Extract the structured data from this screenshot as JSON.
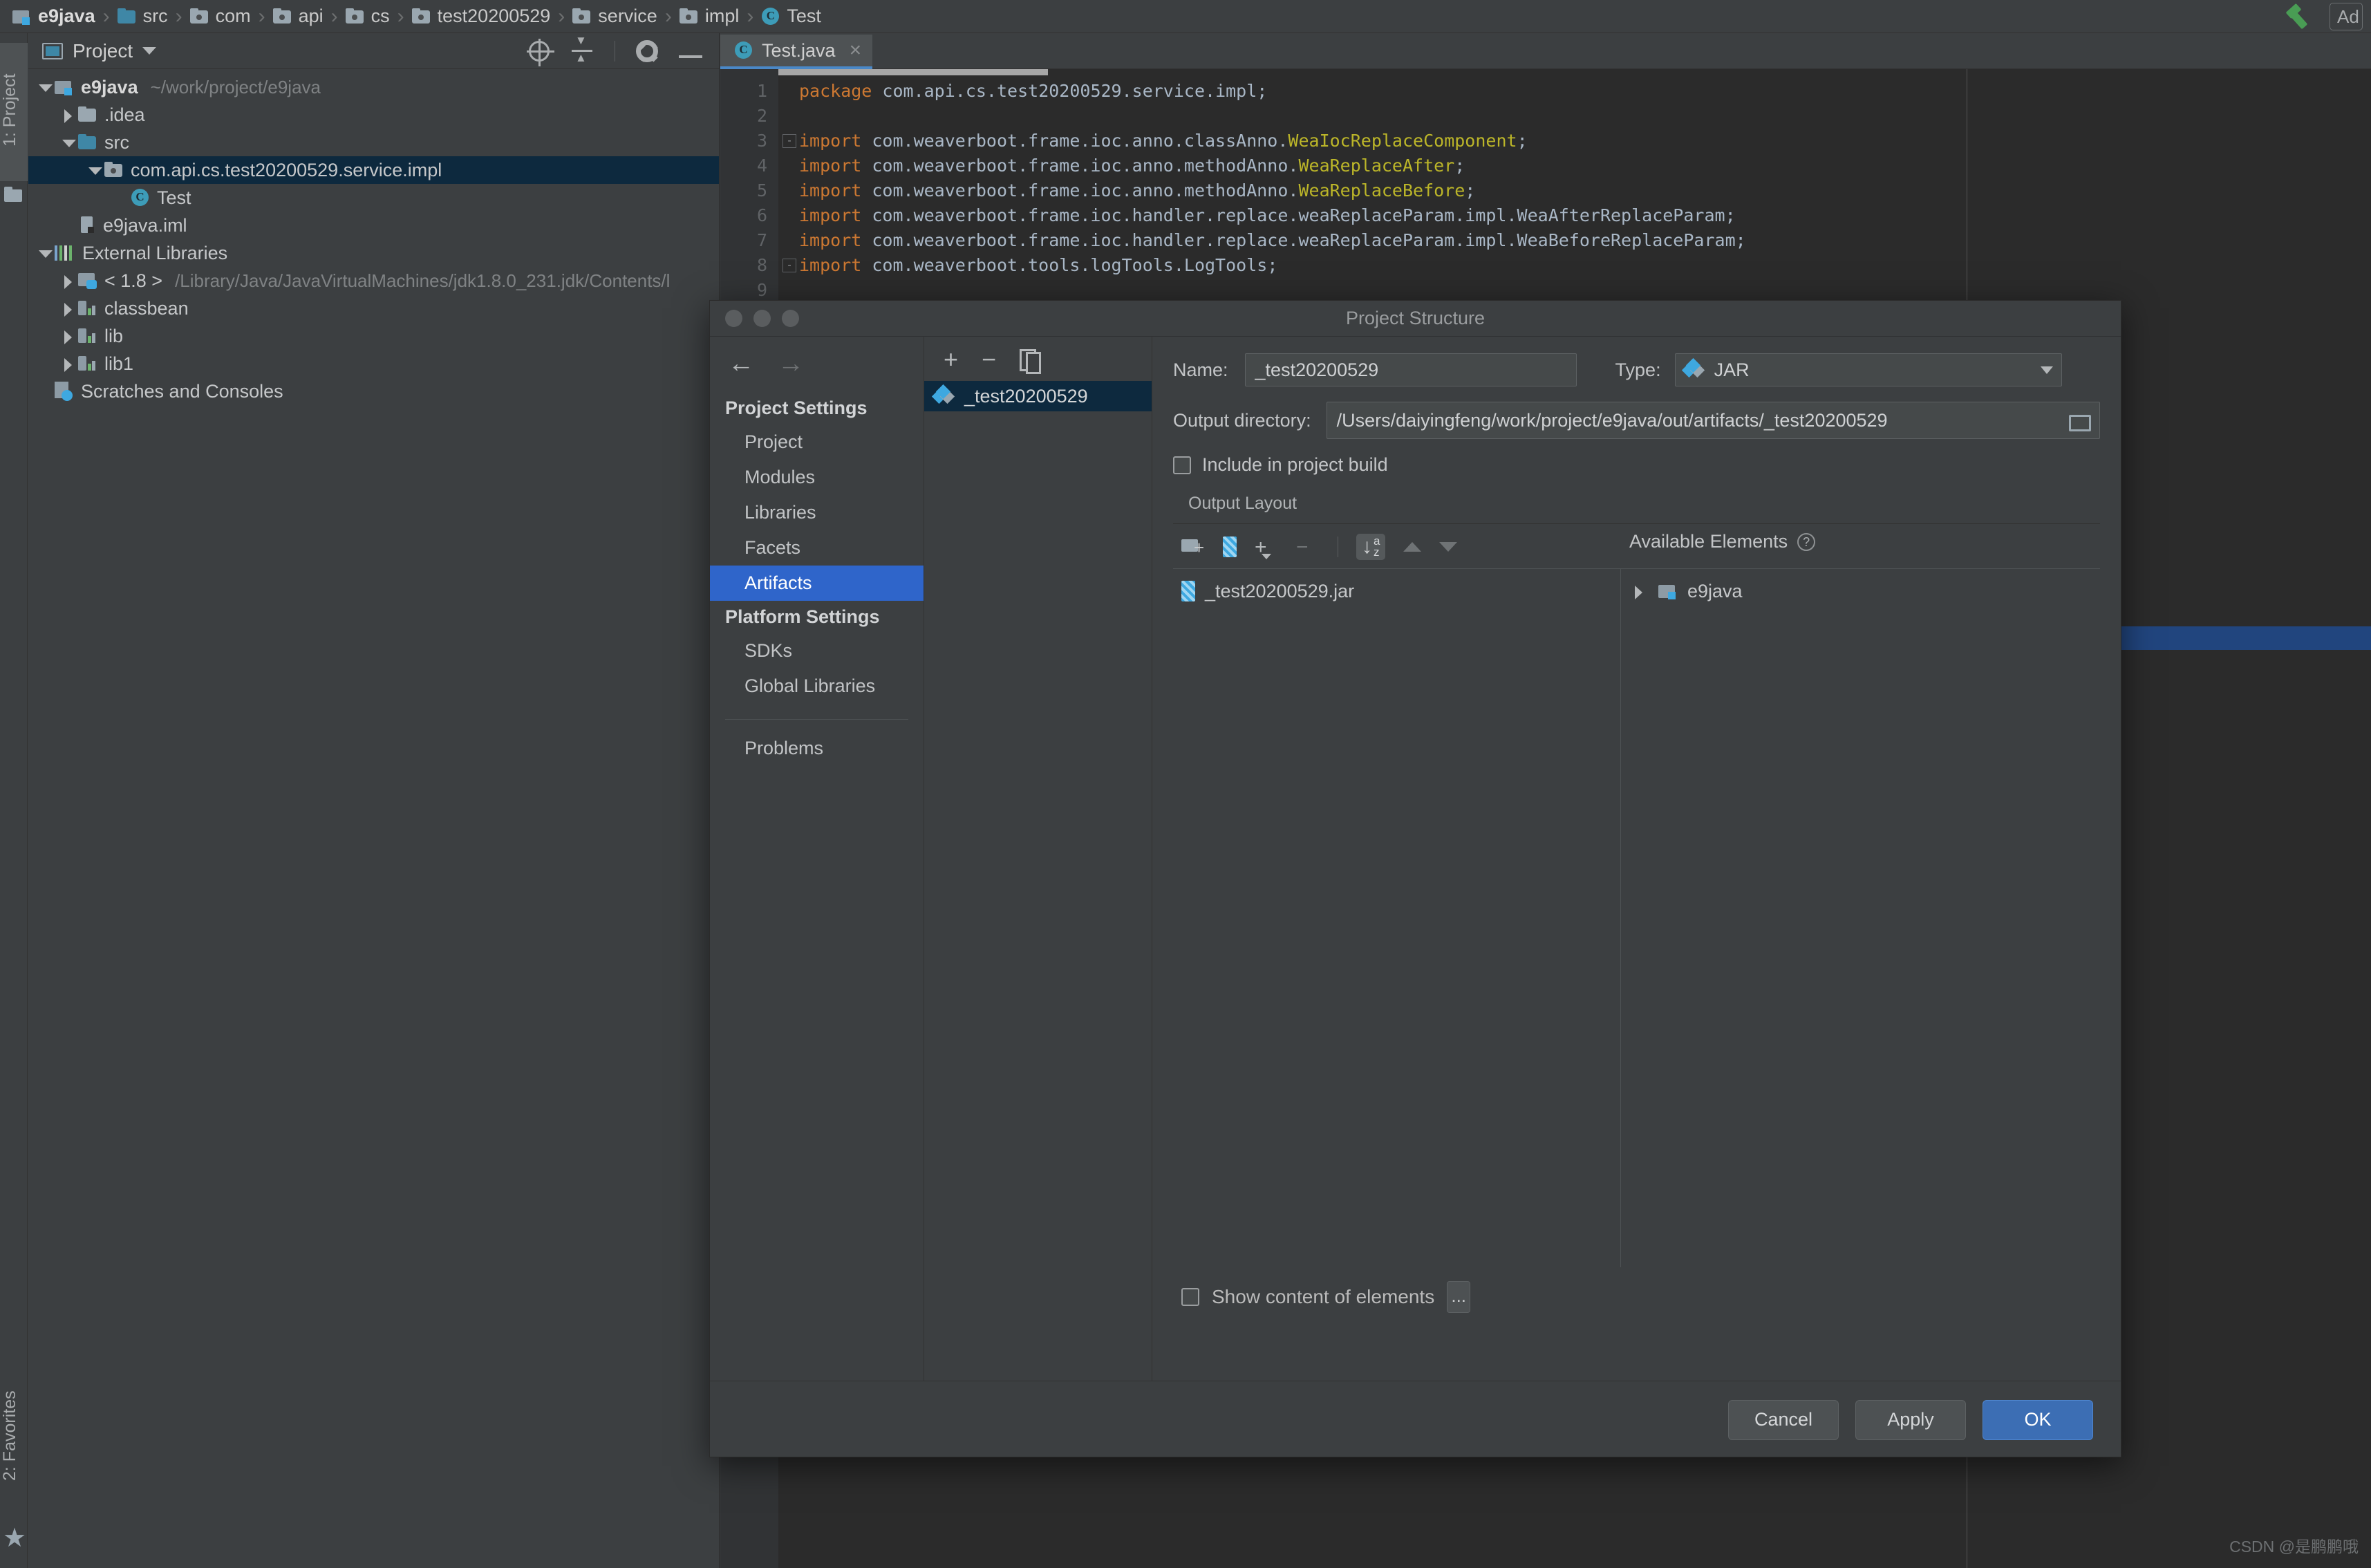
{
  "navbar": {
    "breadcrumbs": [
      {
        "label": "e9java",
        "icon": "module-icon",
        "bold": true
      },
      {
        "label": "src",
        "icon": "folder-source-icon",
        "bold": false
      },
      {
        "label": "com",
        "icon": "folder-package-icon",
        "bold": false
      },
      {
        "label": "api",
        "icon": "folder-package-icon",
        "bold": false
      },
      {
        "label": "cs",
        "icon": "folder-package-icon",
        "bold": false
      },
      {
        "label": "test20200529",
        "icon": "folder-package-icon",
        "bold": false
      },
      {
        "label": "service",
        "icon": "folder-package-icon",
        "bold": false
      },
      {
        "label": "impl",
        "icon": "folder-package-icon",
        "bold": false
      },
      {
        "label": "Test",
        "icon": "java-class-icon",
        "bold": false
      }
    ],
    "separator": "›",
    "build_icon": "hammer-icon",
    "add_configuration_label": "Ad"
  },
  "tool_strip": {
    "project_tab": "1: Project",
    "favorites_tab": "2: Favorites"
  },
  "project_panel": {
    "title": "Project",
    "tools": [
      "locate-icon",
      "collapse-all-icon",
      "settings-gear-icon",
      "hide-icon"
    ],
    "tree": [
      {
        "label": "e9java",
        "path": "~/work/project/e9java",
        "indent": 0,
        "arrow": "open",
        "icon": "module-icon",
        "bold": true,
        "selected": false
      },
      {
        "label": ".idea",
        "path": "",
        "indent": 1,
        "arrow": "closed",
        "icon": "folder-icon",
        "bold": false,
        "selected": false
      },
      {
        "label": "src",
        "path": "",
        "indent": 1,
        "arrow": "open",
        "icon": "folder-source-icon",
        "bold": false,
        "selected": false
      },
      {
        "label": "com.api.cs.test20200529.service.impl",
        "path": "",
        "indent": 2,
        "arrow": "open",
        "icon": "folder-package-icon",
        "bold": false,
        "selected": true
      },
      {
        "label": "Test",
        "path": "",
        "indent": 3,
        "arrow": "none",
        "icon": "java-class-icon",
        "bold": false,
        "selected": false
      },
      {
        "label": "e9java.iml",
        "path": "",
        "indent": 1,
        "arrow": "none",
        "icon": "iml-file-icon",
        "bold": false,
        "selected": false
      },
      {
        "label": "External Libraries",
        "path": "",
        "indent": 0,
        "arrow": "open",
        "icon": "external-libraries-icon",
        "bold": false,
        "selected": false
      },
      {
        "label": "< 1.8 >",
        "path": "/Library/Java/JavaVirtualMachines/jdk1.8.0_231.jdk/Contents/l",
        "indent": 1,
        "arrow": "closed",
        "icon": "jdk-icon",
        "bold": false,
        "selected": false
      },
      {
        "label": "classbean",
        "path": "",
        "indent": 1,
        "arrow": "closed",
        "icon": "library-icon",
        "bold": false,
        "selected": false
      },
      {
        "label": "lib",
        "path": "",
        "indent": 1,
        "arrow": "closed",
        "icon": "library-icon",
        "bold": false,
        "selected": false
      },
      {
        "label": "lib1",
        "path": "",
        "indent": 1,
        "arrow": "closed",
        "icon": "library-icon",
        "bold": false,
        "selected": false
      },
      {
        "label": "Scratches and Consoles",
        "path": "",
        "indent": 0,
        "arrow": "none",
        "icon": "scratches-icon",
        "bold": false,
        "selected": false
      }
    ]
  },
  "editor": {
    "tab": {
      "label": "Test.java",
      "icon": "java-class-icon",
      "close": "×"
    },
    "lines": [
      {
        "num": "1",
        "segments": [
          {
            "t": "package ",
            "c": "kw"
          },
          {
            "t": "com.api.cs.test20200529.service.impl",
            "c": "pl"
          },
          {
            "t": ";",
            "c": "sc"
          }
        ],
        "fold": ""
      },
      {
        "num": "2",
        "segments": [],
        "fold": ""
      },
      {
        "num": "3",
        "segments": [
          {
            "t": "import ",
            "c": "kw"
          },
          {
            "t": "com.weaverboot.frame.ioc.anno.classAnno.",
            "c": "pl"
          },
          {
            "t": "WeaIocReplaceComponent",
            "c": "hl"
          },
          {
            "t": ";",
            "c": "sc"
          }
        ],
        "fold": "-"
      },
      {
        "num": "4",
        "segments": [
          {
            "t": "import ",
            "c": "kw"
          },
          {
            "t": "com.weaverboot.frame.ioc.anno.methodAnno.",
            "c": "pl"
          },
          {
            "t": "WeaReplaceAfter",
            "c": "hl"
          },
          {
            "t": ";",
            "c": "sc"
          }
        ],
        "fold": ""
      },
      {
        "num": "5",
        "segments": [
          {
            "t": "import ",
            "c": "kw"
          },
          {
            "t": "com.weaverboot.frame.ioc.anno.methodAnno.",
            "c": "pl"
          },
          {
            "t": "WeaReplaceBefore",
            "c": "hl"
          },
          {
            "t": ";",
            "c": "sc"
          }
        ],
        "fold": ""
      },
      {
        "num": "6",
        "segments": [
          {
            "t": "import ",
            "c": "kw"
          },
          {
            "t": "com.weaverboot.frame.ioc.handler.replace.weaReplaceParam.impl.WeaAfterReplaceParam",
            "c": "pl"
          },
          {
            "t": ";",
            "c": "sc"
          }
        ],
        "fold": ""
      },
      {
        "num": "7",
        "segments": [
          {
            "t": "import ",
            "c": "kw"
          },
          {
            "t": "com.weaverboot.frame.ioc.handler.replace.weaReplaceParam.impl.WeaBeforeReplaceParam",
            "c": "pl"
          },
          {
            "t": ";",
            "c": "sc"
          }
        ],
        "fold": ""
      },
      {
        "num": "8",
        "segments": [
          {
            "t": "import ",
            "c": "kw"
          },
          {
            "t": "com.weaverboot.tools.logTools.LogTools",
            "c": "pl"
          },
          {
            "t": ";",
            "c": "sc"
          }
        ],
        "fold": "-"
      },
      {
        "num": "9",
        "segments": [],
        "fold": ""
      }
    ]
  },
  "dialog": {
    "title": "Project Structure",
    "nav": {
      "back_icon": "arrow-left-icon",
      "forward_icon": "arrow-right-icon",
      "groups": [
        {
          "group": "Project Settings",
          "items": [
            {
              "label": "Project",
              "active": false
            },
            {
              "label": "Modules",
              "active": false
            },
            {
              "label": "Libraries",
              "active": false
            },
            {
              "label": "Facets",
              "active": false
            },
            {
              "label": "Artifacts",
              "active": true
            }
          ]
        },
        {
          "group": "Platform Settings",
          "items": [
            {
              "label": "SDKs",
              "active": false
            },
            {
              "label": "Global Libraries",
              "active": false
            }
          ]
        }
      ],
      "problems_label": "Problems"
    },
    "artifact_list": {
      "tools": [
        "add-icon",
        "remove-icon",
        "copy-icon"
      ],
      "items": [
        {
          "label": "_test20200529",
          "selected": true,
          "icon": "artifact-jar-icon"
        }
      ]
    },
    "form": {
      "name_label": "Name:",
      "name_value": "_test20200529",
      "type_label": "Type:",
      "type_value": "JAR",
      "type_icon": "artifact-jar-icon",
      "output_directory_label": "Output directory:",
      "output_directory_value": "/Users/daiyingfeng/work/project/e9java/out/artifacts/_test20200529",
      "browse_icon": "folder-browse-icon",
      "include_in_build_label": "Include in project build",
      "include_in_build_checked": false,
      "output_layout_label": "Output Layout"
    },
    "layout_toolbar": {
      "icons": [
        "create-directory-icon",
        "create-archive-icon",
        "add-copy-icon",
        "remove-icon",
        "sort-az-icon",
        "move-up-icon",
        "move-down-icon"
      ],
      "sort_label_down": "↓",
      "sort_label_a": "a",
      "sort_label_z": "z"
    },
    "available_elements": {
      "header": "Available Elements",
      "help_icon": "help-icon",
      "items": [
        {
          "label": "e9java",
          "arrow": "closed",
          "icon": "module-icon"
        }
      ]
    },
    "output_layout_tree": [
      {
        "label": "_test20200529.jar",
        "icon": "archive-icon"
      }
    ],
    "show_content_label": "Show content of elements",
    "show_content_checked": false,
    "dots_button_label": "...",
    "buttons": [
      {
        "label": "Cancel",
        "primary": false
      },
      {
        "label": "Apply",
        "primary": false
      },
      {
        "label": "OK",
        "primary": true
      }
    ]
  },
  "watermark": "CSDN @是鹏鹏哦",
  "colors": {
    "accent_blue": "#2f65ca",
    "selection_blue": "#0d293e",
    "primary_button": "#3c6eb4",
    "panel_bg": "#3c3f41",
    "editor_bg": "#2b2b2b"
  }
}
